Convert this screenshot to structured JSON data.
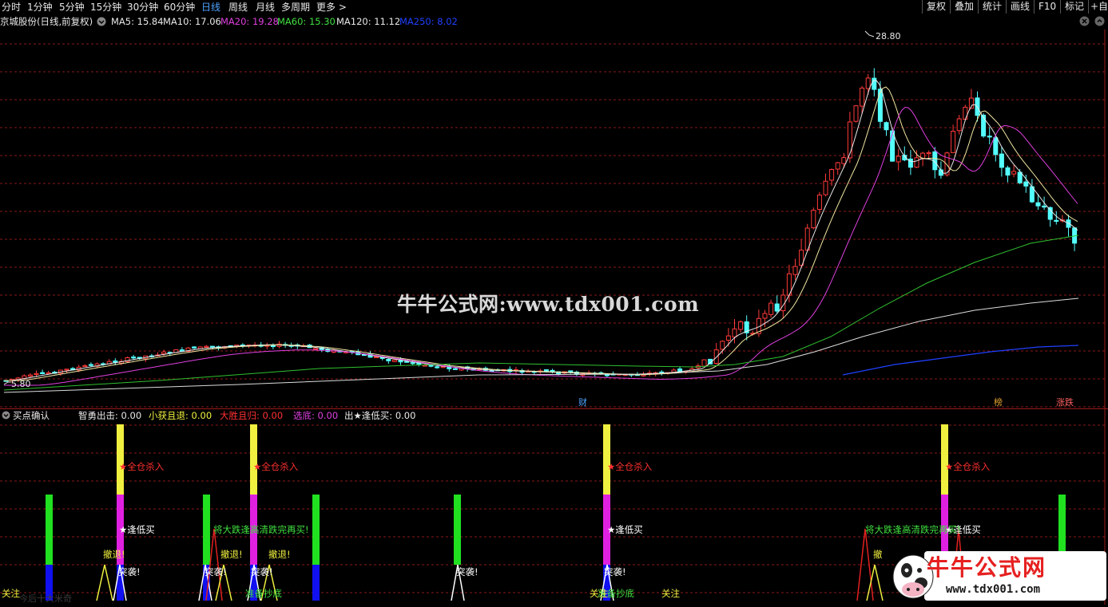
{
  "timeframe_tabs": [
    "分时",
    "1分钟",
    "5分钟",
    "15分钟",
    "30分钟",
    "60分钟",
    "日线",
    "周线",
    "月线",
    "多周期",
    "更多 >"
  ],
  "active_tab": "日线",
  "right_buttons": [
    "复权",
    "叠加",
    "统计",
    "画线",
    "F10",
    "标记",
    "+自"
  ],
  "stock_title": "京城股份(日线,前复权)",
  "ma_labels": [
    {
      "text": "MA5: 15.84",
      "color": "#e8e8e8"
    },
    {
      "text": "MA10: 17.06",
      "color": "#e8e8e8"
    },
    {
      "text": "MA20: 19.28",
      "color": "#e040e0"
    },
    {
      "text": "MA60: 15.30",
      "color": "#40e040"
    },
    {
      "text": "MA120: 11.12",
      "color": "#e8e8e8"
    },
    {
      "text": "MA250: 8.02",
      "color": "#2040ff"
    }
  ],
  "price_high_label": "28.80",
  "price_low_label": "5.80",
  "event_markers": [
    {
      "text": "财",
      "color": "#4fa3ff"
    },
    {
      "text": "榜",
      "color": "#e0a030"
    },
    {
      "text": "涨跌",
      "color": "#ff6060"
    }
  ],
  "watermark": "牛牛公式网:www.tdx001.com",
  "indicator": {
    "name": "买点确认",
    "values": [
      {
        "text": "智勇出击: 0.00",
        "color": "#e8e8e8"
      },
      {
        "text": "小获且退: 0.00",
        "color": "#f0f040"
      },
      {
        "text": "大胜且归: 0.00",
        "color": "#ff3030"
      },
      {
        "text": "选底: 0.00",
        "color": "#e040e0"
      },
      {
        "text": "出★逢低买: 0.00",
        "color": "#e8e8e8"
      }
    ]
  },
  "signal_texts": [
    {
      "text": "★全仓杀入",
      "color": "#ff3030"
    },
    {
      "text": "★全仓杀入",
      "color": "#ff3030"
    },
    {
      "text": "★全仓杀入",
      "color": "#ff3030"
    },
    {
      "text": "★全仓杀入",
      "color": "#ff3030"
    },
    {
      "text": "★逢低买",
      "color": "#ffffff"
    },
    {
      "text": "★逢低买",
      "color": "#ffffff"
    },
    {
      "text": "★逢低买",
      "color": "#ffffff"
    },
    {
      "text": "将大跌逢高清跌完再买!",
      "color": "#40e040"
    },
    {
      "text": "将大跌逢高清跌完再买!",
      "color": "#40e040"
    },
    {
      "text": "撤退!",
      "color": "#f0f040"
    },
    {
      "text": "撤退!",
      "color": "#f0f040"
    },
    {
      "text": "撤退!",
      "color": "#f0f040"
    },
    {
      "text": "撤",
      "color": "#f0f040"
    },
    {
      "text": "突袭!",
      "color": "#ffffff"
    },
    {
      "text": "突袭!",
      "color": "#ffffff"
    },
    {
      "text": "突袭!",
      "color": "#ffffff"
    },
    {
      "text": "突袭!",
      "color": "#ffffff"
    },
    {
      "text": "突袭!",
      "color": "#ffffff"
    },
    {
      "text": "准备抄底",
      "color": "#40e040"
    },
    {
      "text": "准备抄底",
      "color": "#40e040"
    },
    {
      "text": "关注",
      "color": "#f0f040"
    },
    {
      "text": "关注",
      "color": "#f0f040"
    },
    {
      "text": "关注",
      "color": "#f0f040"
    },
    {
      "text": "关注",
      "color": "#f0f040"
    }
  ],
  "bottom_left_faint": "今后十大米奇",
  "logo_text": "牛牛公式网",
  "logo_url": "www.tdx001.com",
  "colors": {
    "up": "#ff3a3a",
    "down": "#54ffff",
    "grid": "#8a1a1a",
    "ma5": "#e8e8e8",
    "ma20": "#e040e0",
    "ma60": "#30c030",
    "ma120": "#dcdcdc",
    "ma250": "#2040ff"
  }
}
